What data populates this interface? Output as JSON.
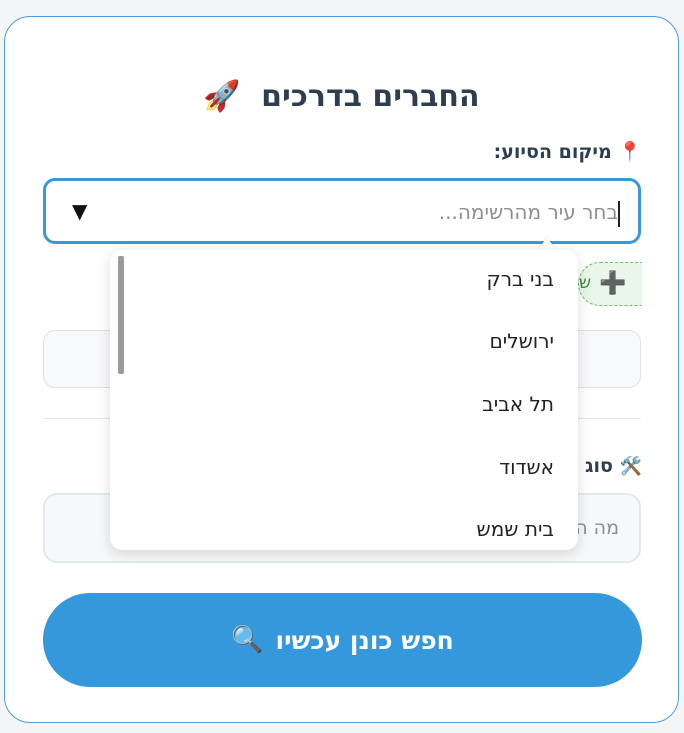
{
  "form": {
    "title": "החברים בדרכים",
    "title_icon": "🚀",
    "location_label": "מיקום הסיוע:",
    "location_icon": "📍",
    "city_placeholder": "בחר עיר מהרשימה...",
    "dropdown_arrow": "▼",
    "add_pill_text": "ש",
    "add_pill_icon": "➕",
    "service_label": "סוג",
    "service_icon": "🛠️",
    "service_placeholder": "מה ה",
    "search_button": "חפש כונן עכשיו",
    "search_icon": "🔍"
  },
  "dropdown": {
    "items": [
      "בני ברק",
      "ירושלים",
      "תל אביב",
      "אשדוד",
      "בית שמש"
    ]
  },
  "colors": {
    "accent": "#3598dc",
    "border": "#4a9fd8",
    "title": "#2c3e50"
  }
}
